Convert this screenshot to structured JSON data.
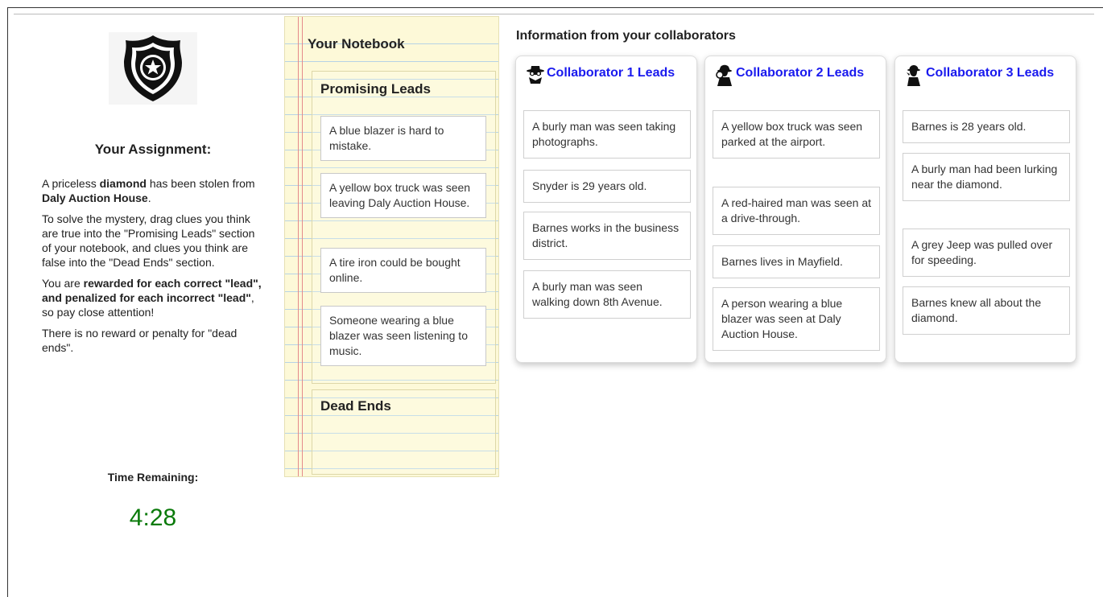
{
  "assignment": {
    "title": "Your Assignment:",
    "p1": [
      {
        "t": "A priceless ",
        "b": false
      },
      {
        "t": "diamond",
        "b": true
      },
      {
        "t": " has been stolen from ",
        "b": false
      },
      {
        "t": "Daly Auction House",
        "b": true
      },
      {
        "t": ".",
        "b": false
      }
    ],
    "p2": "To solve the mystery, drag clues you think are true into the \"Promising Leads\" section of your notebook, and clues you think are false into the \"Dead Ends\" section.",
    "p3": [
      {
        "t": "You are ",
        "b": false
      },
      {
        "t": "rewarded for each correct \"lead\", and penalized for each incorrect \"lead\"",
        "b": true
      },
      {
        "t": ", so pay close attention!",
        "b": false
      }
    ],
    "p4": "There is no reward or penalty for \"dead ends\".",
    "time_label": "Time Remaining:",
    "time_value": "4:28"
  },
  "notebook": {
    "title": "Your Notebook",
    "promising_title": "Promising Leads",
    "promising_leads": [
      "A blue blazer is hard to mistake.",
      "A yellow box truck was seen leaving Daly Auction House.",
      "A tire iron could be bought online.",
      "Someone wearing a blue blazer was seen listening to music."
    ],
    "dead_ends_title": "Dead Ends"
  },
  "collaborators": {
    "heading": "Information from your collaborators",
    "columns": [
      {
        "title": "Collaborator 1 Leads",
        "icon": "spy-hat-icon",
        "clues": [
          "A burly man was seen taking photographs.",
          "Snyder is 29 years old.",
          "Barnes works in the business district.",
          "A burly man was seen walking down 8th Avenue."
        ]
      },
      {
        "title": "Collaborator 2 Leads",
        "icon": "detective-magnifier-icon",
        "clues": [
          "A yellow box truck was seen parked at the airport.",
          "A red-haired man was seen at a drive-through.",
          "Barnes lives in Mayfield.",
          "A person wearing a blue blazer was seen at Daly Auction House."
        ]
      },
      {
        "title": "Collaborator 3 Leads",
        "icon": "detective-silhouette-icon",
        "clues": [
          "Barnes is 28 years old.",
          "A burly man had been lurking near the diamond.",
          "A grey Jeep was pulled over for speeding.",
          "Barnes knew all about the diamond."
        ]
      }
    ]
  },
  "colors": {
    "timer": "#0a7a0a",
    "collaborator_title": "#1a1aee",
    "notebook_paper": "#fdf9d8",
    "notebook_rule": "#b6d3e6",
    "notebook_margin": "#e58a8a"
  }
}
